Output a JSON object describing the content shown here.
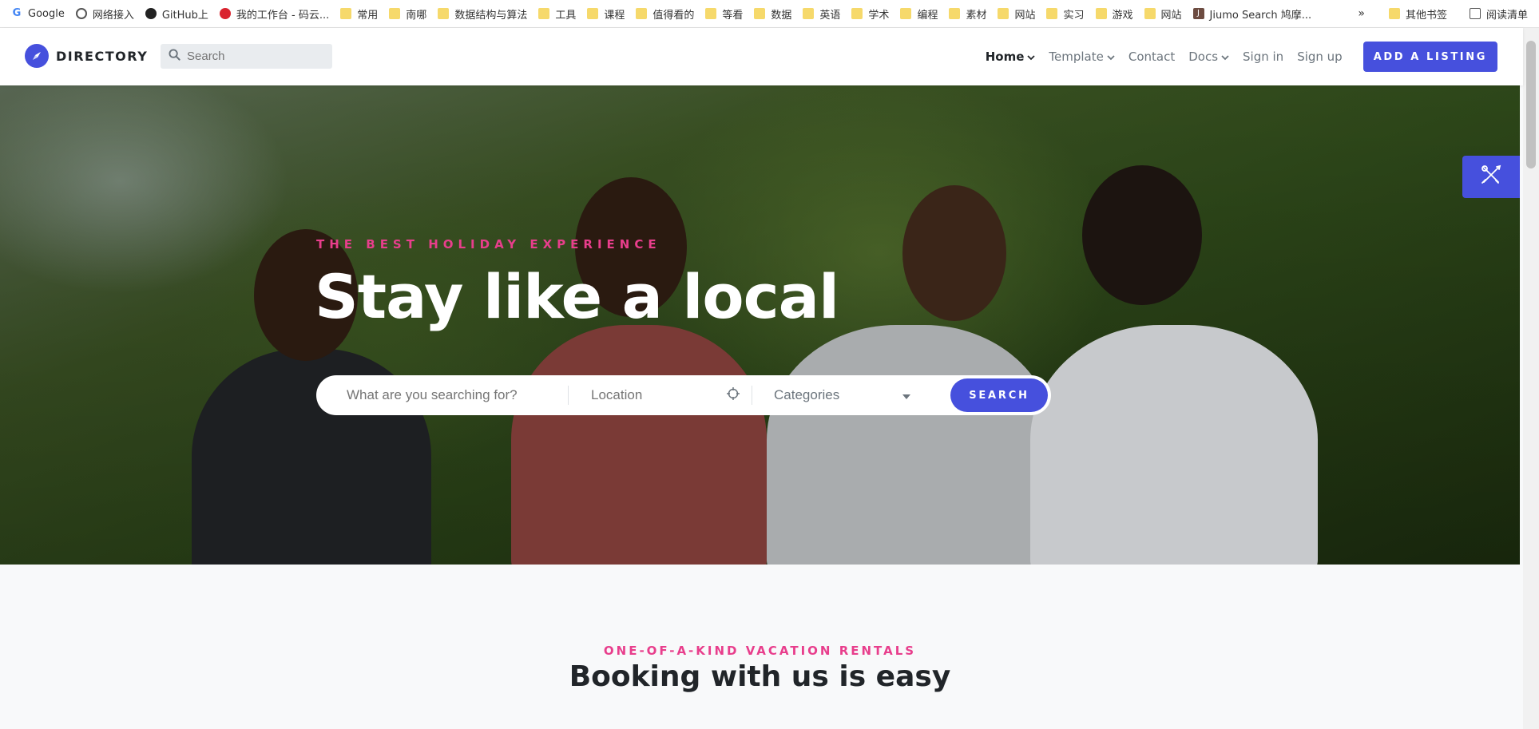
{
  "bookmarks": {
    "items": [
      {
        "label": "Google",
        "icon": "google-icon"
      },
      {
        "label": "网络接入",
        "icon": "globe-icon"
      },
      {
        "label": "GitHub上",
        "icon": "github-icon"
      },
      {
        "label": "我的工作台 - 码云...",
        "icon": "gitee-icon"
      },
      {
        "label": "常用",
        "icon": "folder-icon"
      },
      {
        "label": "南哪",
        "icon": "folder-icon"
      },
      {
        "label": "数据结构与算法",
        "icon": "folder-icon"
      },
      {
        "label": "工具",
        "icon": "folder-icon"
      },
      {
        "label": "课程",
        "icon": "folder-icon"
      },
      {
        "label": "值得看的",
        "icon": "folder-icon"
      },
      {
        "label": "等看",
        "icon": "folder-icon"
      },
      {
        "label": "数据",
        "icon": "folder-icon"
      },
      {
        "label": "英语",
        "icon": "folder-icon"
      },
      {
        "label": "学术",
        "icon": "folder-icon"
      },
      {
        "label": "编程",
        "icon": "folder-icon"
      },
      {
        "label": "素材",
        "icon": "folder-icon"
      },
      {
        "label": "网站",
        "icon": "folder-icon"
      },
      {
        "label": "实习",
        "icon": "folder-icon"
      },
      {
        "label": "游戏",
        "icon": "folder-icon"
      },
      {
        "label": "网站",
        "icon": "folder-icon"
      },
      {
        "label": "Jiumo Search 鸠摩...",
        "icon": "jiumo-icon"
      }
    ],
    "more": "»",
    "other": "其他书签",
    "reading_list": "阅读清单"
  },
  "navbar": {
    "brand": "DIRECTORY",
    "search_placeholder": "Search",
    "links": [
      {
        "label": "Home",
        "dropdown": true,
        "active": true
      },
      {
        "label": "Template",
        "dropdown": true,
        "active": false
      },
      {
        "label": "Contact",
        "dropdown": false,
        "active": false
      },
      {
        "label": "Docs",
        "dropdown": true,
        "active": false
      },
      {
        "label": "Sign in",
        "dropdown": false,
        "active": false
      },
      {
        "label": "Sign up",
        "dropdown": false,
        "active": false
      }
    ],
    "cta": "ADD A LISTING"
  },
  "hero": {
    "subtitle": "THE BEST HOLIDAY EXPERIENCE",
    "title": "Stay like a local",
    "search": {
      "what_placeholder": "What are you searching for?",
      "location_placeholder": "Location",
      "categories_label": "Categories",
      "button": "SEARCH"
    }
  },
  "section": {
    "subtitle": "ONE-OF-A-KIND VACATION RENTALS",
    "title": "Booking with us is easy"
  },
  "colors": {
    "primary": "#4650dd",
    "accent": "#e83e8c",
    "heading": "#212529"
  }
}
